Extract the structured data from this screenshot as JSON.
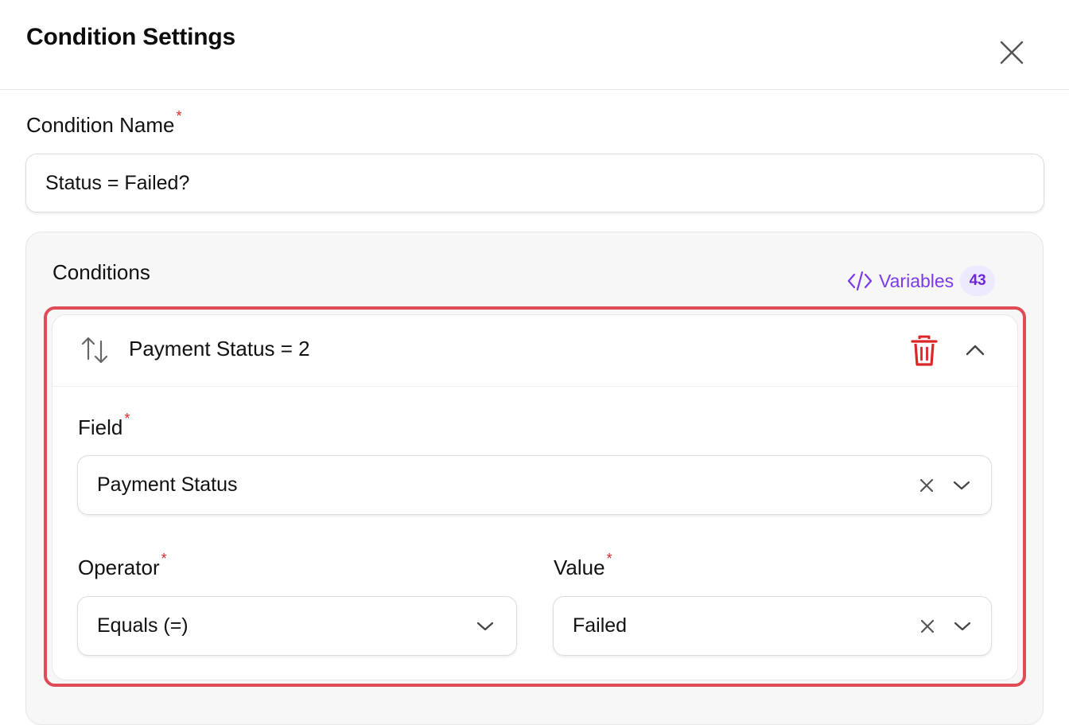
{
  "header": {
    "title": "Condition Settings",
    "close_icon": "close-icon"
  },
  "condition_name": {
    "label": "Condition Name",
    "required_mark": "*",
    "value": "Status = Failed?"
  },
  "conditions": {
    "title": "Conditions",
    "variables": {
      "icon": "code-icon",
      "label": "Variables",
      "count": "43"
    },
    "items": [
      {
        "summary": "Payment Status = 2",
        "field": {
          "label": "Field",
          "required_mark": "*",
          "value": "Payment Status"
        },
        "operator": {
          "label": "Operator",
          "required_mark": "*",
          "value": "Equals (=)"
        },
        "value": {
          "label": "Value",
          "required_mark": "*",
          "value": "Failed"
        }
      }
    ]
  },
  "colors": {
    "accent_purple": "#7c3aed",
    "danger_red": "#dc2626",
    "highlight_border": "#df4b57"
  }
}
